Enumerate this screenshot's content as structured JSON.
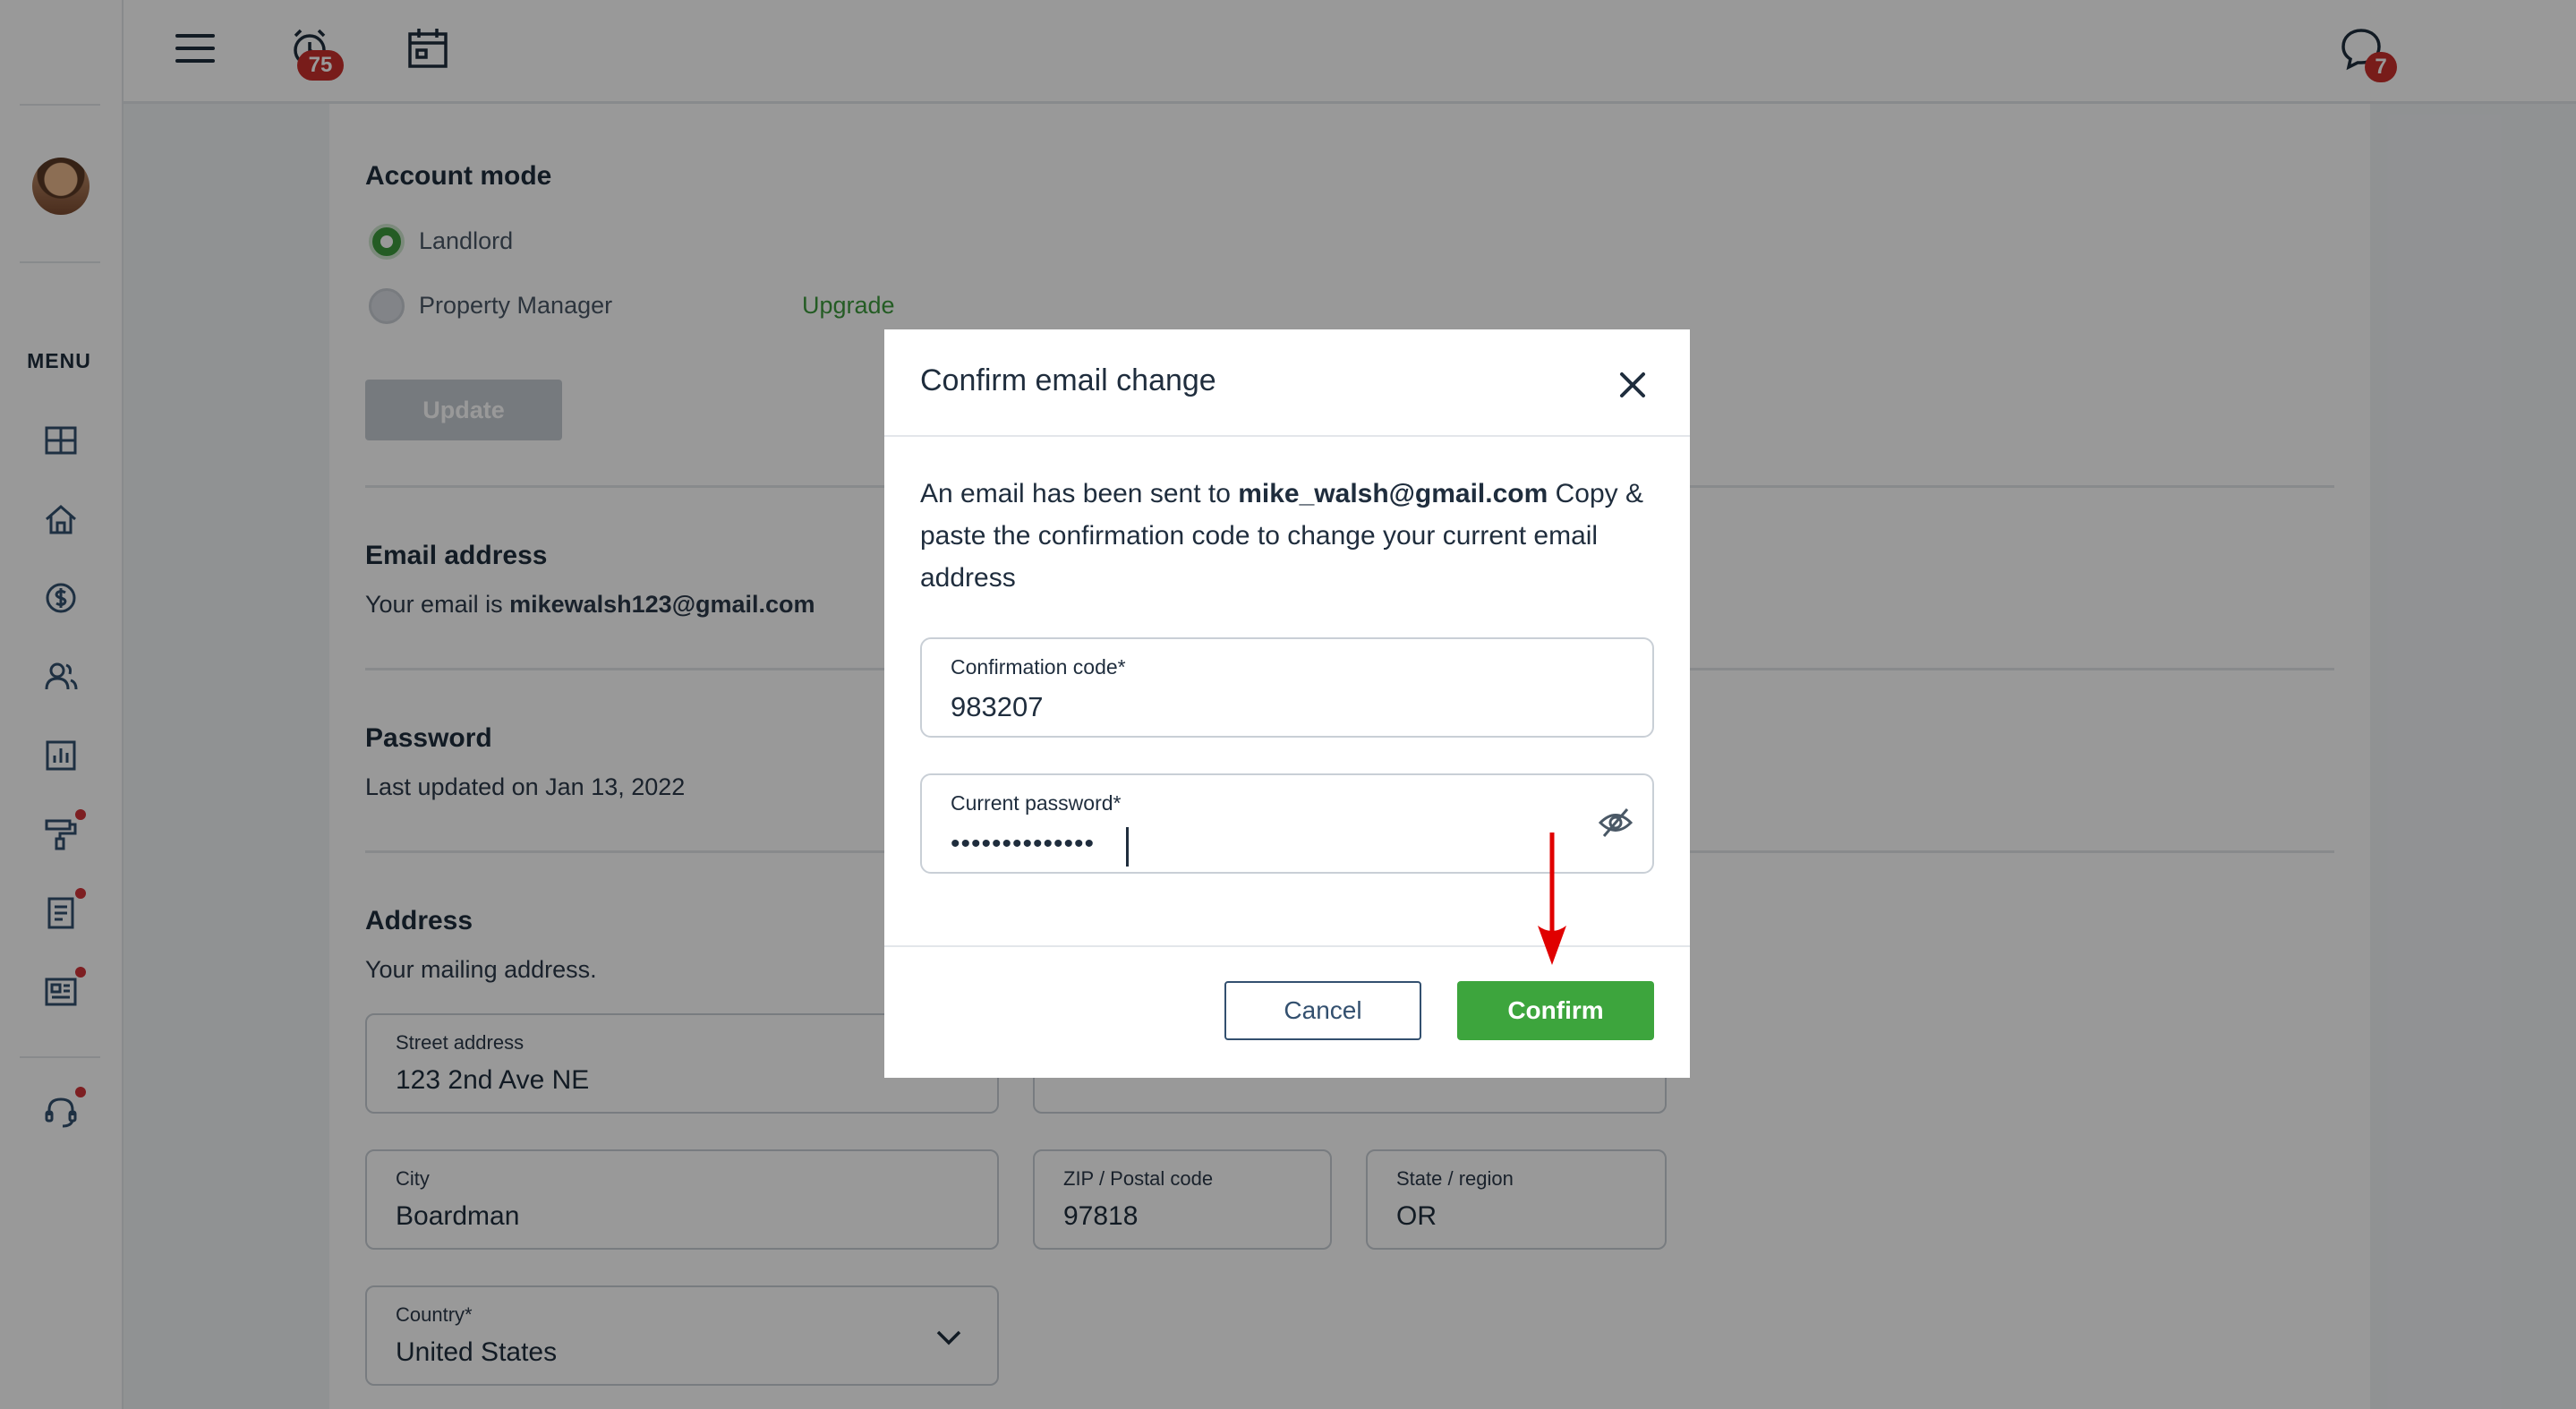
{
  "topbar": {
    "alarm_badge": "75",
    "chat_badge": "7"
  },
  "sidebar": {
    "menu_label": "MENU"
  },
  "account_mode": {
    "title": "Account mode",
    "option_landlord": "Landlord",
    "option_property_manager": "Property Manager",
    "upgrade_link": "Upgrade",
    "update_button": "Update",
    "selected": "Landlord"
  },
  "email_section": {
    "title": "Email address",
    "prefix": "Your email is ",
    "email": "mikewalsh123@gmail.com"
  },
  "password_section": {
    "title": "Password",
    "last_updated": "Last updated on Jan 13, 2022"
  },
  "address_section": {
    "title": "Address",
    "subtitle": "Your mailing address.",
    "street_label": "Street address",
    "street_value": "123 2nd Ave NE",
    "city_label": "City",
    "city_value": "Boardman",
    "zip_label": "ZIP / Postal code",
    "zip_value": "97818",
    "state_label": "State / region",
    "state_value": "OR",
    "country_label": "Country*",
    "country_value": "United States"
  },
  "modal": {
    "title": "Confirm email change",
    "text_before": "An email has been sent to ",
    "email": "mike_walsh@gmail.com",
    "text_after": " Copy & paste the confirmation code to change your current email address",
    "code_label": "Confirmation code*",
    "code_value": "983207",
    "password_label": "Current password*",
    "password_masked": "••••••••••••••",
    "cancel_label": "Cancel",
    "confirm_label": "Confirm"
  },
  "colors": {
    "accent_green": "#3da53d",
    "badge_red": "#c9302c",
    "arrow_red": "#e00000",
    "overlay": "rgba(0,0,0,0.40)"
  },
  "icons": {
    "topbar": [
      "hamburger-menu-icon",
      "alarm-clock-icon",
      "calendar-icon",
      "chat-bubble-icon",
      "gear-icon"
    ],
    "sidebar": [
      "dashboard-icon",
      "home-icon",
      "dollar-icon",
      "people-icon",
      "chart-icon",
      "paint-roller-icon",
      "document-icon",
      "news-icon",
      "headset-icon"
    ],
    "modal": [
      "close-icon",
      "eye-off-icon"
    ]
  }
}
